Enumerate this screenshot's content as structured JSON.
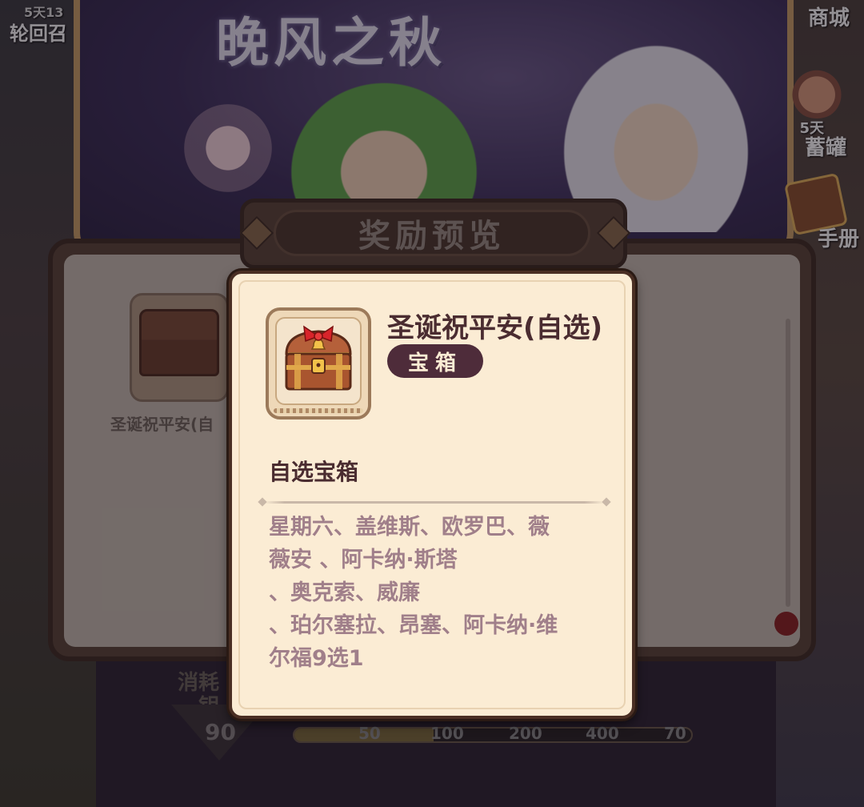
{
  "banner": {
    "title": "晚风之秋"
  },
  "left_event": {
    "timer": "5天13",
    "name": "轮回召"
  },
  "right_menu": {
    "shop": "商城",
    "jar_timer": "5天",
    "jar": "蓄罐",
    "manual": "手册"
  },
  "preview": {
    "title": "奖励预览",
    "slot_label": "圣诞祝平安(自",
    "consume_label": "消耗",
    "key_label": "钥",
    "cost": "90",
    "progress": {
      "fill_fraction": 0.35,
      "ticks": [
        "50",
        "100",
        "200",
        "400",
        "70"
      ]
    }
  },
  "tooltip": {
    "item_name": "圣诞祝平安(自选)",
    "item_type": "宝箱",
    "desc_title": "自选宝箱",
    "desc_body": "星期六、盖维斯、欧罗巴、薇\n薇安 、阿卡纳·斯塔\n、奥克索、威廉\n、珀尔塞拉、昂塞、阿卡纳·维\n尔福9选1",
    "icon": "treasure-chest-icon"
  },
  "colors": {
    "card_bg": "#fbecd4",
    "card_border": "#4a2f24",
    "title_text": "#4a2c30",
    "badge_bg": "#4e2c3a",
    "body_text": "#a07f8a"
  }
}
